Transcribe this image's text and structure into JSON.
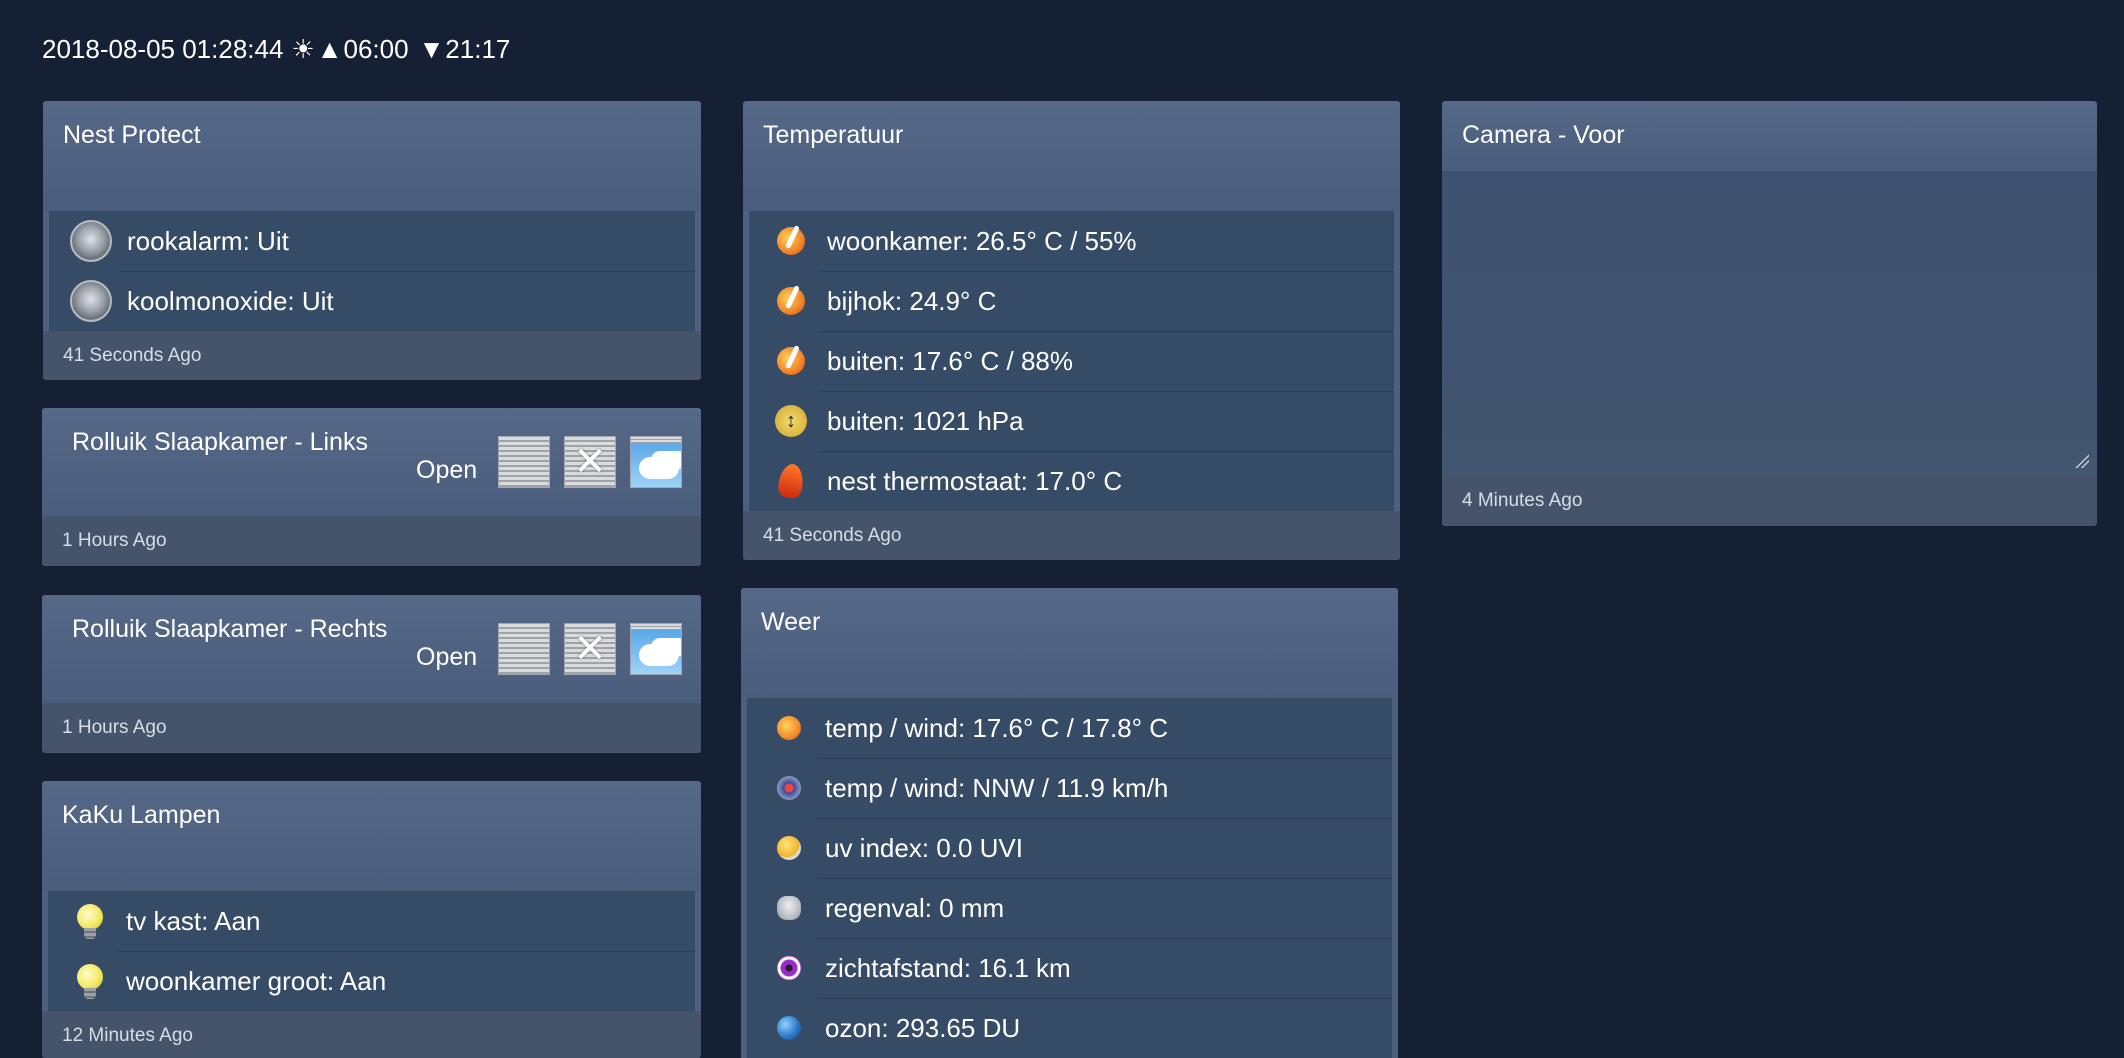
{
  "topbar": {
    "datetime": "2018-08-05 01:28:44",
    "sun_symbol": "☀",
    "sunrise_symbol": "▲",
    "sunrise": "06:00",
    "sunset_symbol": "▼",
    "sunset": "21:17"
  },
  "nest": {
    "title": "Nest Protect",
    "rows": [
      {
        "label": "rookalarm: Uit",
        "icon": "smoke-detector-icon"
      },
      {
        "label": "koolmonoxide: Uit",
        "icon": "smoke-detector-icon"
      }
    ],
    "footer": "41 Seconds Ago"
  },
  "rolluik_links": {
    "title": "Rolluik Slaapkamer - Links",
    "state": "Open",
    "stop_symbol": "✕",
    "footer": "1 Hours Ago"
  },
  "rolluik_rechts": {
    "title": "Rolluik Slaapkamer - Rechts",
    "state": "Open",
    "stop_symbol": "✕",
    "footer": "1 Hours Ago"
  },
  "kaku": {
    "title": "KaKu Lampen",
    "rows": [
      {
        "label": "tv kast: Aan",
        "icon": "light-bulb-icon"
      },
      {
        "label": "woonkamer groot: Aan",
        "icon": "light-bulb-icon"
      }
    ],
    "footer": "12 Minutes Ago"
  },
  "temperatuur": {
    "title": "Temperatuur",
    "rows": [
      {
        "label": "woonkamer: 26.5° C / 55%",
        "icon": "thermometer-icon"
      },
      {
        "label": "bijhok: 24.9° C",
        "icon": "thermometer-icon"
      },
      {
        "label": "buiten: 17.6° C / 88%",
        "icon": "thermometer-icon"
      },
      {
        "label": "buiten: 1021 hPa",
        "icon": "barometer-icon"
      },
      {
        "label": "nest thermostaat: 17.0° C",
        "icon": "flame-icon"
      }
    ],
    "footer": "41 Seconds Ago"
  },
  "weer": {
    "title": "Weer",
    "rows": [
      {
        "label": "temp / wind: 17.6° C / 17.8° C",
        "icon": "temperature-icon"
      },
      {
        "label": "temp / wind: NNW / 11.9 km/h",
        "icon": "wind-compass-icon"
      },
      {
        "label": "uv index: 0.0 UVI",
        "icon": "uv-sun-icon"
      },
      {
        "label": "regenval: 0 mm",
        "icon": "rain-cloud-icon"
      },
      {
        "label": "zichtafstand: 16.1 km",
        "icon": "visibility-eye-icon"
      },
      {
        "label": "ozon: 293.65 DU",
        "icon": "ozone-globe-icon"
      }
    ]
  },
  "camera": {
    "title": "Camera - Voor",
    "footer": "4 Minutes Ago"
  }
}
